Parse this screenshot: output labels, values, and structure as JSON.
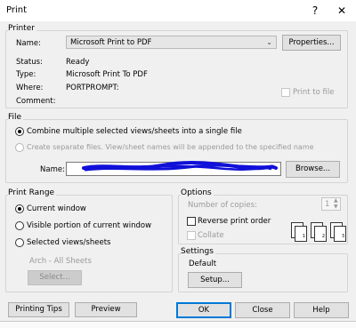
{
  "window": {
    "title": "Print",
    "help_glyph": "?",
    "close_glyph": "✕"
  },
  "printer": {
    "group_label": "Printer",
    "name_label": "Name:",
    "name_value": "Microsoft Print to PDF",
    "properties_button": "Properties...",
    "status_label": "Status:",
    "status_value": "Ready",
    "type_label": "Type:",
    "type_value": "Microsoft Print To PDF",
    "where_label": "Where:",
    "where_value": "PORTPROMPT:",
    "comment_label": "Comment:",
    "print_to_file_label": "Print to file"
  },
  "file": {
    "group_label": "File",
    "combine_label": "Combine multiple selected views/sheets into a single file",
    "separate_label": "Create separate files. View/sheet names will be appended to the specified name",
    "name_label": "Name:",
    "browse_button": "Browse..."
  },
  "print_range": {
    "group_label": "Print Range",
    "current_window_label": "Current window",
    "visible_portion_label": "Visible portion of current window",
    "selected_views_label": "Selected views/sheets",
    "set_label": "Arch - All Sheets",
    "select_button": "Select..."
  },
  "options": {
    "group_label": "Options",
    "copies_label": "Number of copies:",
    "copies_value": "1",
    "reverse_label": "Reverse print order",
    "collate_label": "Collate"
  },
  "settings": {
    "group_label": "Settings",
    "current_value": "Default",
    "setup_button": "Setup..."
  },
  "footer": {
    "printing_tips_button": "Printing Tips",
    "preview_button": "Preview",
    "ok_button": "OK",
    "close_button": "Close",
    "help_button": "Help"
  },
  "colors": {
    "scribble": "#1010d8",
    "focus_blue": "#0078d7"
  }
}
